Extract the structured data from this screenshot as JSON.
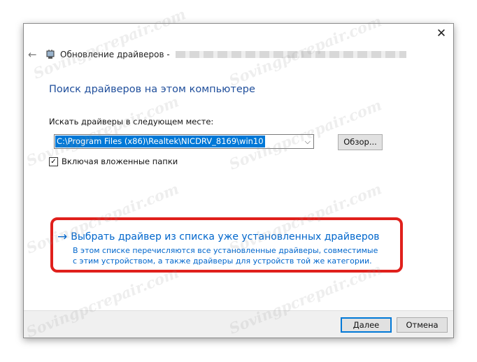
{
  "dialog": {
    "title": "Обновление драйверов -",
    "heading": "Поиск драйверов на этом компьютере",
    "search_label": "Искать драйверы в следующем месте:",
    "path_value": "C:\\Program Files (x86)\\Realtek\\NICDRV_8169\\win10",
    "browse_label": "Обзор...",
    "include_subfolders_label": "Включая вложенные папки",
    "include_subfolders_checked": true,
    "option_title": "Выбрать драйвер из списка уже установленных драйверов",
    "option_description": "В этом списке перечисляются все установленные драйверы, совместимые с этим устройством, а также драйверы для устройств той же категории.",
    "next_label": "Далее",
    "cancel_label": "Отмена"
  },
  "icons": {
    "close": "close-icon",
    "back": "back-arrow-icon",
    "device": "device-icon",
    "option_arrow": "arrow-right-icon",
    "combo": "chevron-down-icon",
    "checkbox": "checkmark-icon"
  },
  "watermark": "Sovingpcrepair.com",
  "colors": {
    "heading": "#1f4e9b",
    "link": "#0066cc",
    "selection": "#0078d7",
    "highlight_frame": "#e0201c",
    "footer": "#f0f0f0"
  }
}
